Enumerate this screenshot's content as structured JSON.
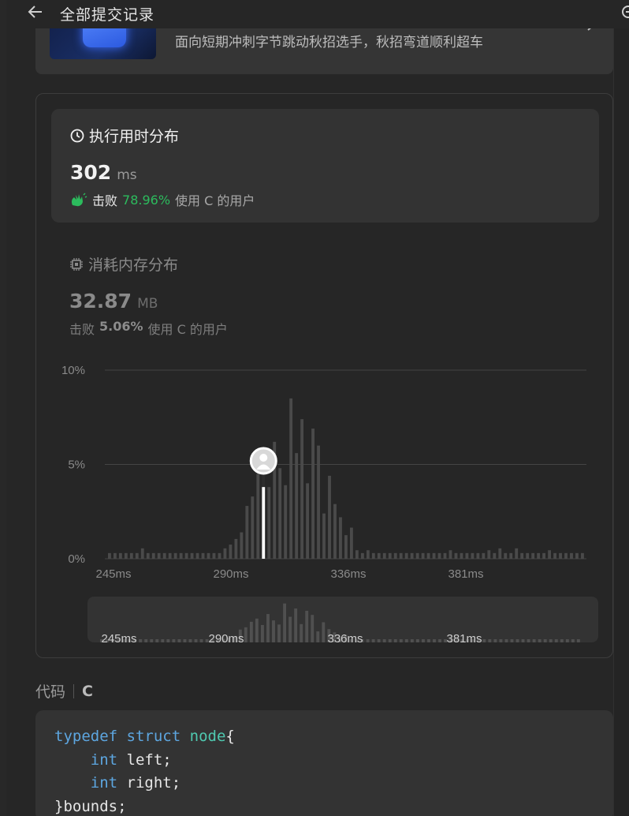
{
  "header": {
    "title": "全部提交记录"
  },
  "banner": {
    "text": "面向短期冲刺字节跳动秋招选手，秋招弯道顺利超车"
  },
  "runtime": {
    "title": "执行用时分布",
    "value": "302",
    "unit": "ms",
    "beat_label": "击败",
    "beat_pct": "78.96%",
    "users_text": "使用 C 的用户"
  },
  "memory": {
    "title": "消耗内存分布",
    "value": "32.87",
    "unit": "MB",
    "beat_label": "击败",
    "beat_pct": "5.06%",
    "users_text": "使用 C 的用户"
  },
  "chart_data": {
    "type": "bar",
    "y_ticks": [
      "10%",
      "5%",
      "0%"
    ],
    "ylim": [
      0,
      10
    ],
    "x_ticks": [
      "245ms",
      "290ms",
      "336ms",
      "381ms"
    ],
    "values": [
      0.3,
      0.3,
      0.3,
      0.3,
      0.3,
      0.3,
      0.55,
      0.3,
      0.3,
      0.3,
      0.3,
      0.3,
      0.3,
      0.3,
      0.3,
      0.3,
      0.3,
      0.3,
      0.3,
      0.3,
      0.3,
      0.55,
      0.75,
      1.05,
      1.4,
      2.8,
      3.3,
      4.5,
      5.2,
      3.8,
      6.2,
      4.8,
      3.9,
      8.5,
      5.6,
      7.4,
      4.0,
      6.9,
      6.0,
      2.4,
      4.4,
      2.9,
      2.2,
      1.25,
      1.65,
      0.45,
      0.3,
      0.45,
      0.3,
      0.3,
      0.3,
      0.3,
      0.3,
      0.3,
      0.3,
      0.3,
      0.3,
      0.3,
      0.3,
      0.3,
      0.3,
      0.3,
      0.45,
      0.3,
      0.3,
      0.3,
      0.3,
      0.3,
      0.3,
      0.45,
      0.3,
      0.55,
      0.3,
      0.3,
      0.55,
      0.3,
      0.3,
      0.3,
      0.3,
      0.3,
      0.45,
      0.3,
      0.3,
      0.3,
      0.3,
      0.3,
      0.3
    ],
    "highlight_index": 28,
    "highlight_value": 3.8,
    "grid": true
  },
  "minimap": {
    "x_ticks": [
      "245ms",
      "290ms",
      "336ms",
      "381ms"
    ]
  },
  "code": {
    "label": "代码",
    "lang": "C",
    "lines": [
      [
        {
          "t": "typedef",
          "c": "kw"
        },
        {
          "t": " ",
          "c": "pl"
        },
        {
          "t": "struct",
          "c": "kw"
        },
        {
          "t": " ",
          "c": "pl"
        },
        {
          "t": "node",
          "c": "ty"
        },
        {
          "t": "{",
          "c": "pl"
        }
      ],
      [
        {
          "t": "    ",
          "c": "pl"
        },
        {
          "t": "int",
          "c": "kw"
        },
        {
          "t": " left;",
          "c": "pl"
        }
      ],
      [
        {
          "t": "    ",
          "c": "pl"
        },
        {
          "t": "int",
          "c": "kw"
        },
        {
          "t": " right;",
          "c": "pl"
        }
      ],
      [
        {
          "t": "}bounds;",
          "c": "pl"
        }
      ]
    ]
  },
  "colors": {
    "accent_green": "#2cbb5d",
    "bar_gray": "#4a4a4a",
    "highlight": "#ffffff",
    "keyword_blue": "#5da6e0",
    "type_teal": "#4fc9b0"
  },
  "icons": [
    "arrow-left-icon",
    "share-icon",
    "chevron-right-icon",
    "clock-icon",
    "clap-icon",
    "chip-icon",
    "avatar-icon"
  ]
}
